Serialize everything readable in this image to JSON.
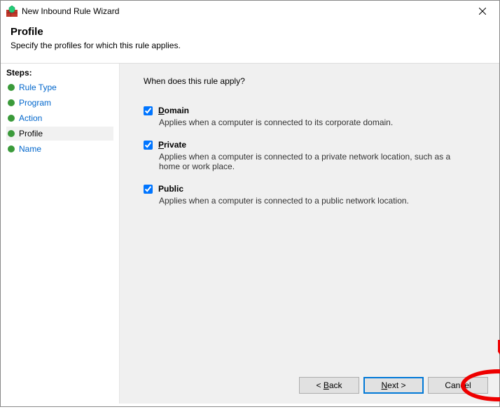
{
  "window": {
    "title": "New Inbound Rule Wizard"
  },
  "header": {
    "heading": "Profile",
    "description": "Specify the profiles for which this rule applies."
  },
  "steps": {
    "heading": "Steps:",
    "items": [
      {
        "label": "Rule Type",
        "selected": false
      },
      {
        "label": "Program",
        "selected": false
      },
      {
        "label": "Action",
        "selected": false
      },
      {
        "label": "Profile",
        "selected": true
      },
      {
        "label": "Name",
        "selected": false
      }
    ]
  },
  "main": {
    "question": "When does this rule apply?",
    "profiles": [
      {
        "name": "Domain",
        "first_letter": "D",
        "rest": "omain",
        "checked": true,
        "description": "Applies when a computer is connected to its corporate domain."
      },
      {
        "name": "Private",
        "first_letter": "P",
        "rest": "rivate",
        "checked": true,
        "description": "Applies when a computer is connected to a private network location, such as a home or work place."
      },
      {
        "name": "Public",
        "first_letter": "P",
        "rest": "ublic",
        "checked": true,
        "description": "Applies when a computer is connected to a public network location."
      }
    ]
  },
  "buttons": {
    "back_letter": "B",
    "back_rest": "ack",
    "back_prefix": "< ",
    "next_letter": "N",
    "next_rest": "ext >",
    "cancel": "Cancel"
  }
}
